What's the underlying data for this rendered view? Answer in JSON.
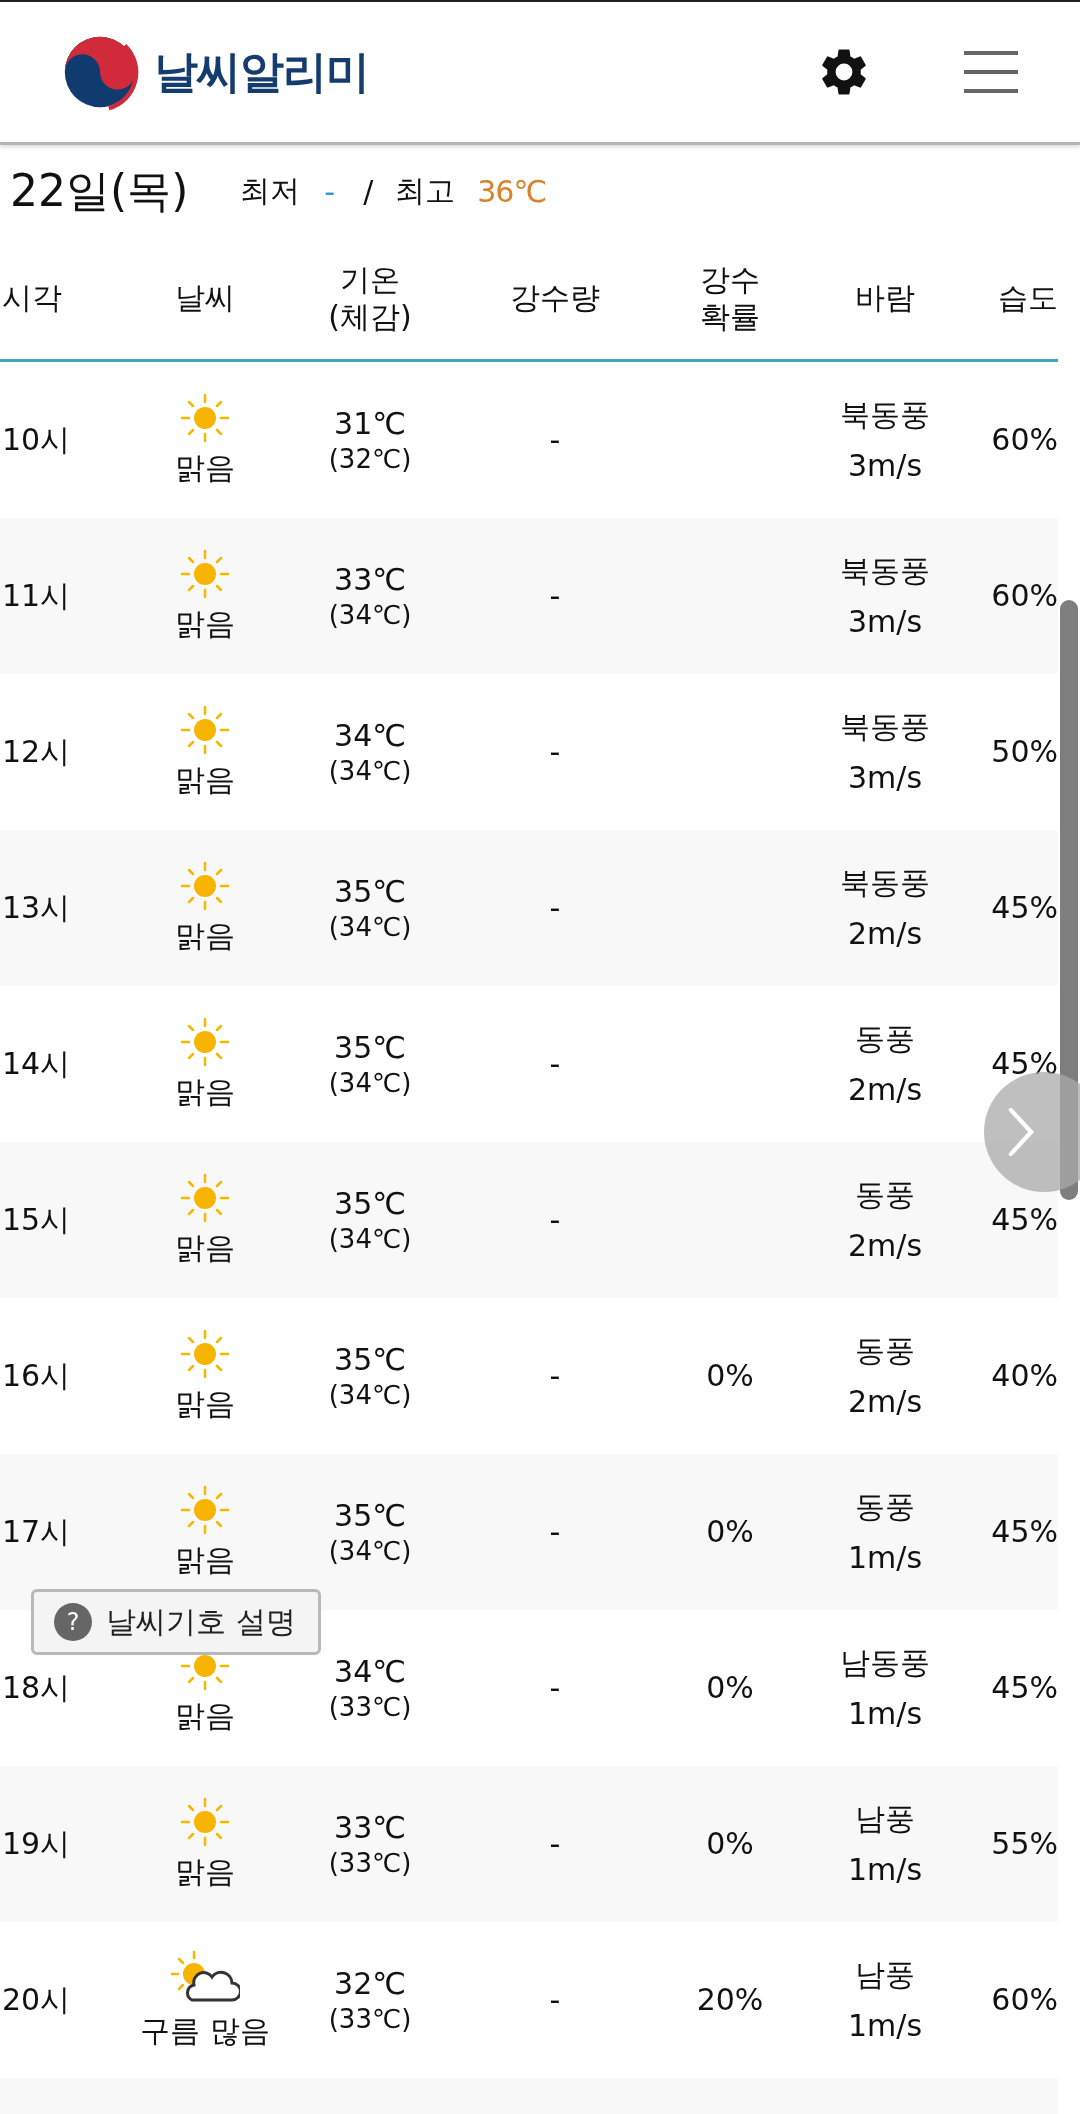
{
  "header": {
    "logo_text": "날씨알리미"
  },
  "day": {
    "date": "22일(목)",
    "min_label": "최저",
    "min_value": "-",
    "separator": "/",
    "max_label": "최고",
    "max_value": "36℃"
  },
  "table": {
    "columns": [
      {
        "label": "시각"
      },
      {
        "label": "날씨"
      },
      {
        "label": "기온\n(체감)"
      },
      {
        "label": "강수량"
      },
      {
        "label": "강수\n확률"
      },
      {
        "label": "바람"
      },
      {
        "label": "습도"
      }
    ],
    "rows": [
      {
        "time": "10시",
        "kind": "sunny",
        "weather": "맑음",
        "temp": "31℃",
        "feels": "(32℃)",
        "precip": "-",
        "wind_dir": "북동풍",
        "wind_speed": "3m/s",
        "humidity": "60%"
      },
      {
        "time": "11시",
        "kind": "sunny",
        "weather": "맑음",
        "temp": "33℃",
        "feels": "(34℃)",
        "precip": "-",
        "wind_dir": "북동풍",
        "wind_speed": "3m/s",
        "humidity": "60%"
      },
      {
        "time": "12시",
        "kind": "sunny",
        "weather": "맑음",
        "temp": "34℃",
        "feels": "(34℃)",
        "precip": "-",
        "wind_dir": "북동풍",
        "wind_speed": "3m/s",
        "humidity": "50%"
      },
      {
        "time": "13시",
        "kind": "sunny",
        "weather": "맑음",
        "temp": "35℃",
        "feels": "(34℃)",
        "precip": "-",
        "wind_dir": "북동풍",
        "wind_speed": "2m/s",
        "humidity": "45%"
      },
      {
        "time": "14시",
        "kind": "sunny",
        "weather": "맑음",
        "temp": "35℃",
        "feels": "(34℃)",
        "precip": "-",
        "wind_dir": "동풍",
        "wind_speed": "2m/s",
        "humidity": "45%"
      },
      {
        "time": "15시",
        "kind": "sunny",
        "weather": "맑음",
        "temp": "35℃",
        "feels": "(34℃)",
        "precip": "-",
        "wind_dir": "동풍",
        "wind_speed": "2m/s",
        "humidity": "45%"
      },
      {
        "time": "16시",
        "kind": "sunny",
        "weather": "맑음",
        "temp": "35℃",
        "feels": "(34℃)",
        "precip": "-",
        "probability": "0%",
        "wind_dir": "동풍",
        "wind_speed": "2m/s",
        "humidity": "40%"
      },
      {
        "time": "17시",
        "kind": "sunny",
        "weather": "맑음",
        "temp": "35℃",
        "feels": "(34℃)",
        "precip": "-",
        "probability": "0%",
        "wind_dir": "동풍",
        "wind_speed": "1m/s",
        "humidity": "45%"
      },
      {
        "time": "18시",
        "kind": "sunny",
        "weather": "맑음",
        "temp": "34℃",
        "feels": "(33℃)",
        "precip": "-",
        "probability": "0%",
        "wind_dir": "남동풍",
        "wind_speed": "1m/s",
        "humidity": "45%"
      },
      {
        "time": "19시",
        "kind": "sunny",
        "weather": "맑음",
        "temp": "33℃",
        "feels": "(33℃)",
        "precip": "-",
        "probability": "0%",
        "wind_dir": "남풍",
        "wind_speed": "1m/s",
        "humidity": "55%"
      },
      {
        "time": "20시",
        "kind": "mostly_cloudy",
        "weather": "구름 많음",
        "temp": "32℃",
        "feels": "(33℃)",
        "precip": "-",
        "probability": "20%",
        "wind_dir": "남풍",
        "wind_speed": "1m/s",
        "humidity": "60%"
      }
    ]
  },
  "legend_button": {
    "icon_text": "?",
    "label": "날씨기호 설명"
  }
}
